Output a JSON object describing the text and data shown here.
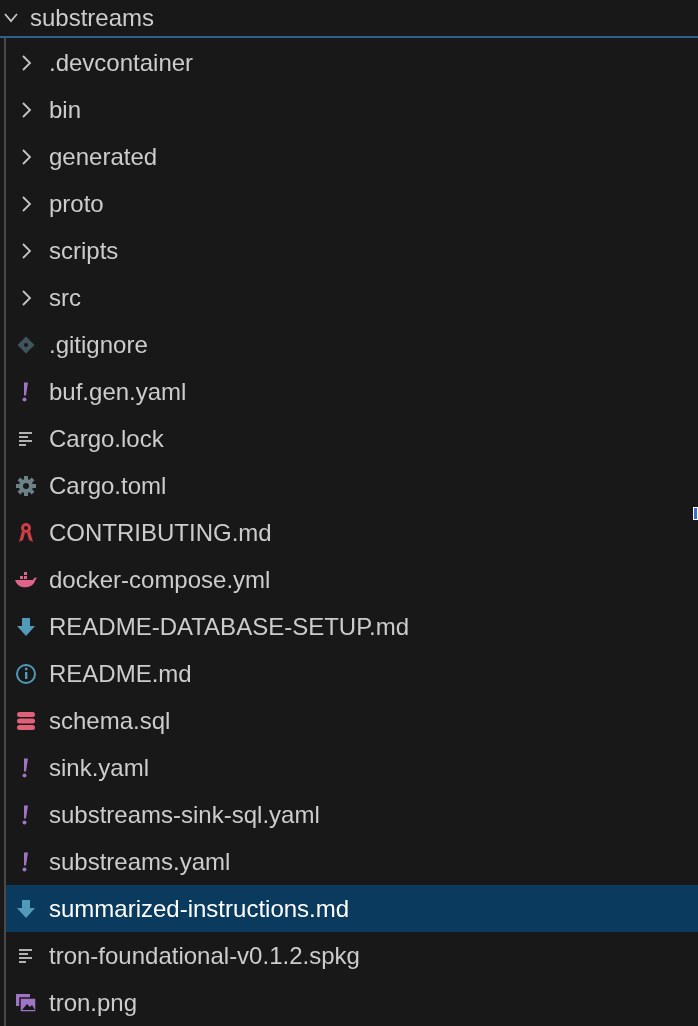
{
  "root": {
    "label": "substreams",
    "expanded": true
  },
  "items": [
    {
      "label": ".devcontainer",
      "kind": "folder",
      "expanded": false,
      "selected": false
    },
    {
      "label": "bin",
      "kind": "folder",
      "expanded": false,
      "selected": false
    },
    {
      "label": "generated",
      "kind": "folder",
      "expanded": false,
      "selected": false
    },
    {
      "label": "proto",
      "kind": "folder",
      "expanded": false,
      "selected": false
    },
    {
      "label": "scripts",
      "kind": "folder",
      "expanded": false,
      "selected": false
    },
    {
      "label": "src",
      "kind": "folder",
      "expanded": false,
      "selected": false
    },
    {
      "label": ".gitignore",
      "kind": "git",
      "selected": false
    },
    {
      "label": "buf.gen.yaml",
      "kind": "yaml",
      "selected": false
    },
    {
      "label": "Cargo.lock",
      "kind": "lines",
      "selected": false
    },
    {
      "label": "Cargo.toml",
      "kind": "gear",
      "selected": false
    },
    {
      "label": "CONTRIBUTING.md",
      "kind": "ribbon",
      "selected": false
    },
    {
      "label": "docker-compose.yml",
      "kind": "whale",
      "selected": false
    },
    {
      "label": "README-DATABASE-SETUP.md",
      "kind": "markdown",
      "selected": false
    },
    {
      "label": "README.md",
      "kind": "info",
      "selected": false
    },
    {
      "label": "schema.sql",
      "kind": "database",
      "selected": false
    },
    {
      "label": "sink.yaml",
      "kind": "yaml",
      "selected": false
    },
    {
      "label": "substreams-sink-sql.yaml",
      "kind": "yaml",
      "selected": false
    },
    {
      "label": "substreams.yaml",
      "kind": "yaml",
      "selected": false
    },
    {
      "label": "summarized-instructions.md",
      "kind": "markdown",
      "selected": true
    },
    {
      "label": "tron-foundational-v0.1.2.spkg",
      "kind": "lines",
      "selected": false
    },
    {
      "label": "tron.png",
      "kind": "image",
      "selected": false
    }
  ]
}
